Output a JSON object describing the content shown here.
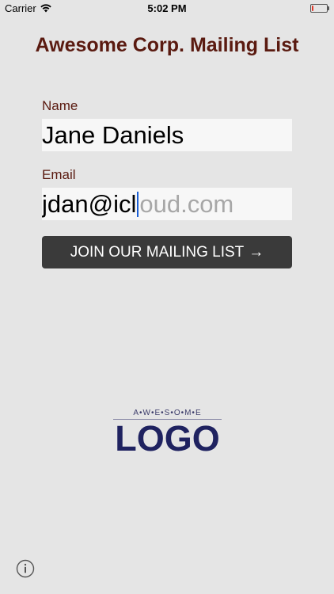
{
  "status_bar": {
    "carrier": "Carrier",
    "time": "5:02 PM",
    "battery_level": 0.12,
    "battery_color": "#e0392b"
  },
  "title": "Awesome Corp. Mailing List",
  "form": {
    "name_label": "Name",
    "name_value": "Jane Daniels",
    "email_label": "Email",
    "email_typed": "jdan@icl",
    "email_autocomplete": "oud.com",
    "submit_label": "JOIN OUR MAILING LIST",
    "submit_icon": "arrow-right-icon"
  },
  "logo": {
    "top_text": "A•W•E•S•O•M•E",
    "main_text": "LOGO"
  },
  "footer": {
    "info_icon": "info-icon"
  },
  "colors": {
    "background": "#e5e5e5",
    "accent_text": "#5a1a10",
    "button_bg": "#3a3a3a",
    "logo_color": "#1f2260"
  }
}
